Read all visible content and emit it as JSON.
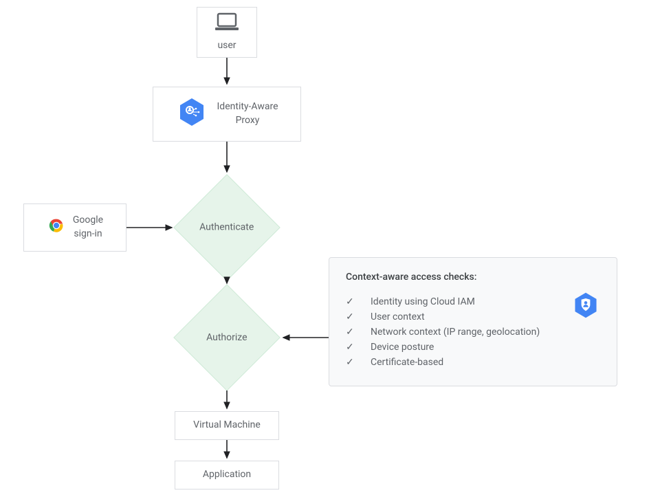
{
  "user": {
    "label": "user"
  },
  "iap": {
    "line1": "Identity-Aware",
    "line2": "Proxy"
  },
  "signin": {
    "line1": "Google",
    "line2": "sign-in"
  },
  "authenticate": {
    "label": "Authenticate"
  },
  "authorize": {
    "label": "Authorize"
  },
  "vm": {
    "label": "Virtual Machine"
  },
  "app": {
    "label": "Application"
  },
  "context": {
    "title": "Context-aware access checks:",
    "items": [
      "Identity using Cloud IAM",
      "User context",
      "Network context (IP range, geolocation)",
      "Device posture",
      "Certificate-based"
    ]
  }
}
